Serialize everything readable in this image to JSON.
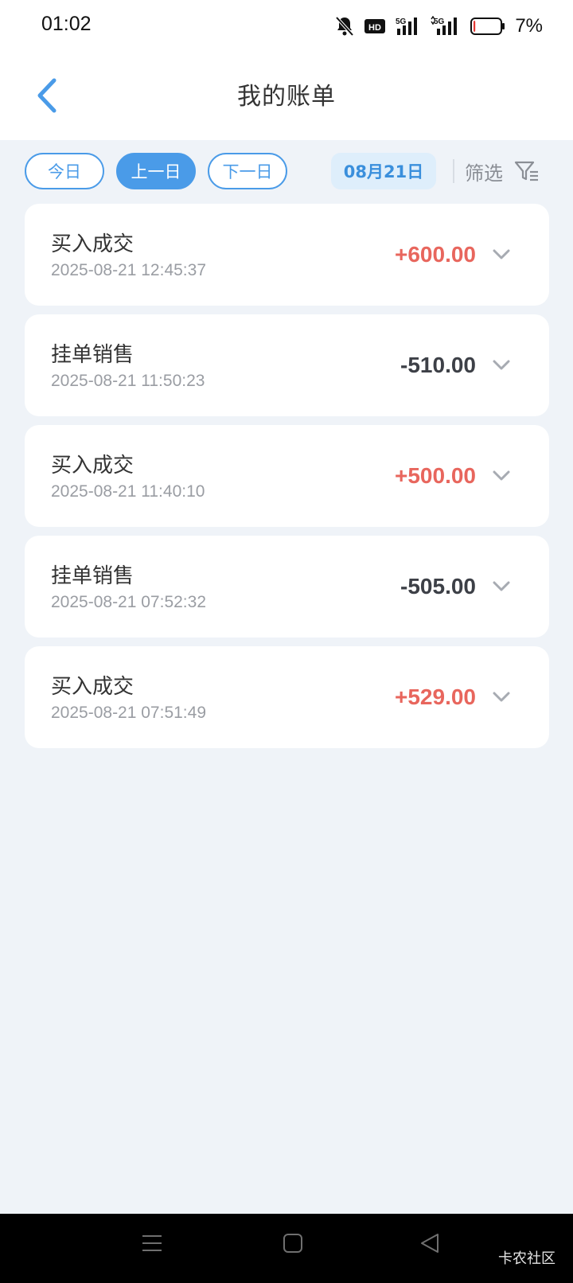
{
  "status_bar": {
    "time": "01:02",
    "battery_percent": "7%",
    "battery_level": 0.07,
    "network_1": "5G",
    "network_2": "5G",
    "hd_label": "HD"
  },
  "header": {
    "title": "我的账单",
    "back_icon": "chevron-left-icon"
  },
  "filters": {
    "today_label": "今日",
    "prev_label": "上一日",
    "next_label": "下一日",
    "active": "上一日",
    "date_label": "08月21日",
    "filter_label": "筛选",
    "accent_color": "#4a9be8"
  },
  "transactions": [
    {
      "title": "买入成交",
      "time": "2025-08-21 12:45:37",
      "amount": "+600.00",
      "direction": "in"
    },
    {
      "title": "挂单销售",
      "time": "2025-08-21 11:50:23",
      "amount": "-510.00",
      "direction": "out"
    },
    {
      "title": "买入成交",
      "time": "2025-08-21 11:40:10",
      "amount": "+500.00",
      "direction": "in"
    },
    {
      "title": "挂单销售",
      "time": "2025-08-21 07:52:32",
      "amount": "-505.00",
      "direction": "out"
    },
    {
      "title": "买入成交",
      "time": "2025-08-21 07:51:49",
      "amount": "+529.00",
      "direction": "in"
    }
  ],
  "colors": {
    "positive": "#e8665d",
    "negative": "#3d4047",
    "background": "#eff3f8"
  },
  "system_nav": {
    "watermark": "卡农社区",
    "menu_icon": "menu-icon",
    "home_icon": "home-square-icon",
    "back_icon": "back-triangle-icon"
  }
}
